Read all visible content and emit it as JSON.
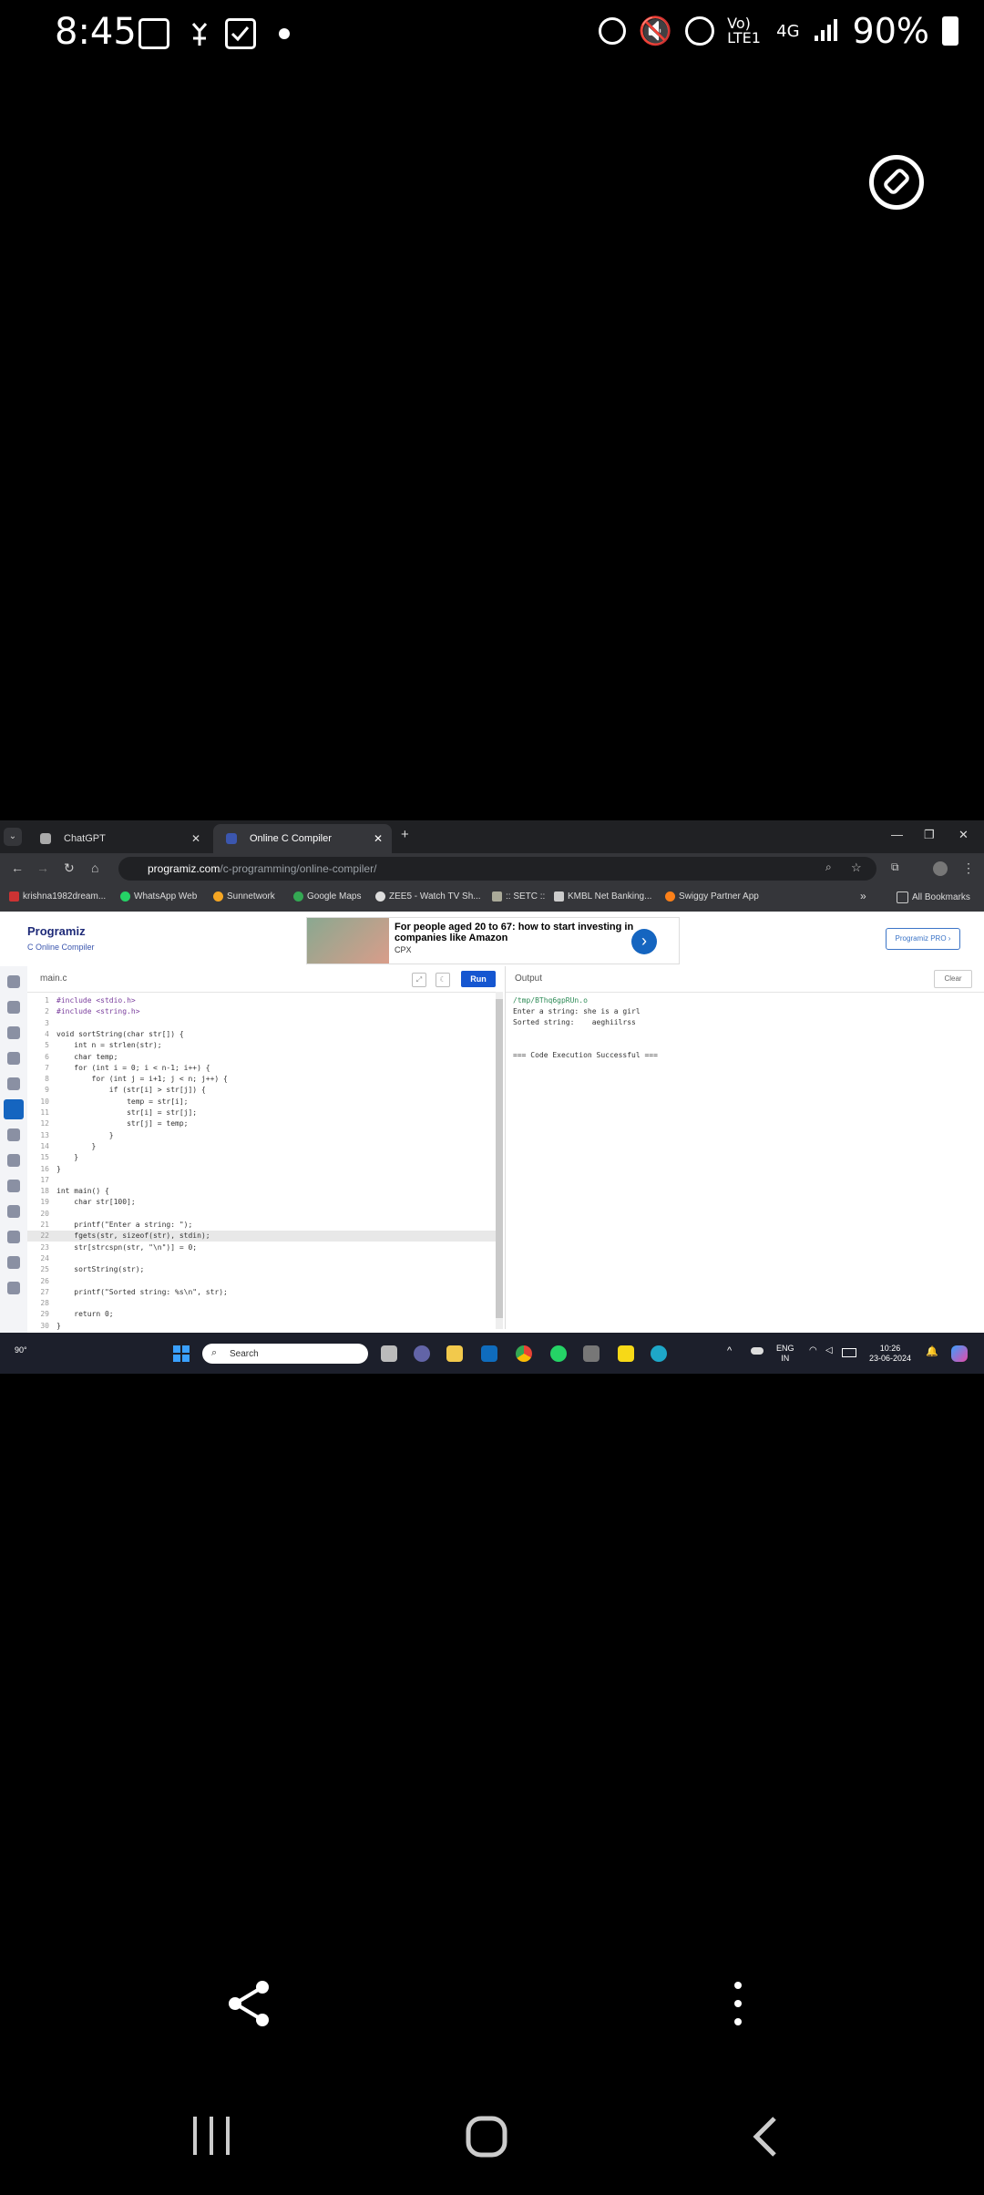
{
  "status_bar": {
    "time": "8:45",
    "network": "Vo) LTE1",
    "signal_type": "4G",
    "battery": "90%",
    "icons": [
      "gallery-icon",
      "notification-icon",
      "checkbox-icon",
      "dot-icon",
      "alarm-icon",
      "mute-icon",
      "hotspot-icon",
      "signal-icon",
      "battery-icon"
    ]
  },
  "browser": {
    "tabs": [
      {
        "label": "ChatGPT",
        "active": false
      },
      {
        "label": "Online C Compiler",
        "active": true
      }
    ],
    "new_tab": "+",
    "url_domain": "programiz.com",
    "url_path": "/c-programming/online-compiler/",
    "bookmarks": [
      "krishna1982dream...",
      "WhatsApp Web",
      "Sunnetwork",
      "Google Maps",
      "ZEE5 - Watch TV Sh...",
      ":: SETC ::",
      "KMBL Net Banking...",
      "Swiggy Partner App"
    ],
    "more_bookmarks": "»",
    "all_bookmarks": "All Bookmarks"
  },
  "page": {
    "logo": "Programiz",
    "logo_sub": "C Online Compiler",
    "ad_title": "For people aged 20 to 67: how to start investing in companies like Amazon",
    "ad_source": "CPX",
    "pro_button": "Programiz PRO ›",
    "editor_tab": "main.c",
    "run_button": "Run",
    "output_title": "Output",
    "clear_button": "Clear",
    "code_lines": [
      "#include <stdio.h>",
      "#include <string.h>",
      "",
      "void sortString(char str[]) {",
      "    int n = strlen(str);",
      "    char temp;",
      "    for (int i = 0; i < n-1; i++) {",
      "        for (int j = i+1; j < n; j++) {",
      "            if (str[i] > str[j]) {",
      "                temp = str[i];",
      "                str[i] = str[j];",
      "                str[j] = temp;",
      "            }",
      "        }",
      "    }",
      "}",
      "",
      "int main() {",
      "    char str[100];",
      "",
      "    printf(\"Enter a string: \");",
      "    fgets(str, sizeof(str), stdin);",
      "    str[strcspn(str, \"\\n\")] = 0;",
      "",
      "    sortString(str);",
      "",
      "    printf(\"Sorted string: %s\\n\", str);",
      "",
      "    return 0;",
      "}"
    ],
    "highlight_line": 22,
    "output_lines": [
      "/tmp/BThq6gpRUn.o",
      "Enter a string: she is a girl",
      "Sorted string:    aeghiilrss",
      "",
      "",
      "=== Code Execution Successful ==="
    ]
  },
  "taskbar": {
    "weather": "90°",
    "search_placeholder": "Search",
    "lang_1": "ENG",
    "lang_2": "IN",
    "time": "10:26",
    "date": "23-06-2024"
  },
  "colors": {
    "run_button": "#1556d0",
    "taskbar": "#1c1f2b",
    "tab_bar": "#202124"
  }
}
